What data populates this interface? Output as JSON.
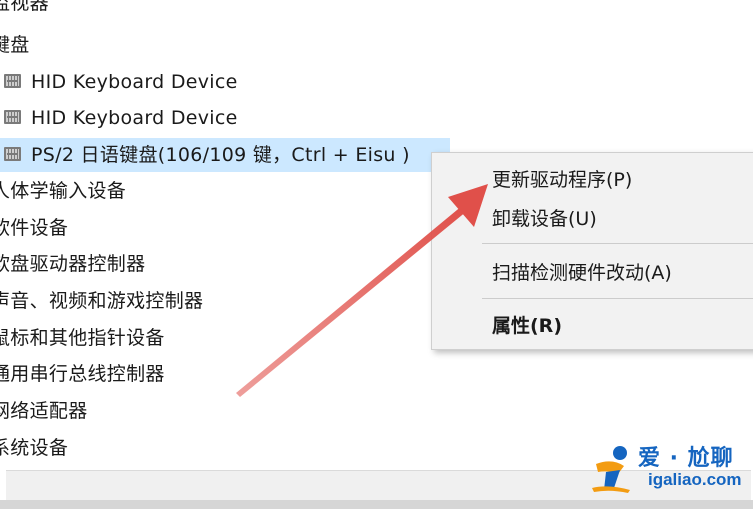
{
  "tree": {
    "partial_top": "监视器",
    "keyboard_category": "键盘",
    "keyboard_devices": [
      {
        "label": "HID Keyboard Device"
      },
      {
        "label": "HID Keyboard Device"
      },
      {
        "label": "PS/2 日语键盘(106/109 键，Ctrl + Eisu )"
      }
    ],
    "categories": [
      {
        "label": "人体学输入设备"
      },
      {
        "label": "软件设备"
      },
      {
        "label": "软盘驱动器控制器"
      },
      {
        "label": "声音、视频和游戏控制器"
      },
      {
        "label": "鼠标和其他指针设备"
      },
      {
        "label": "通用串行总线控制器"
      },
      {
        "label": "网络适配器"
      },
      {
        "label": "系统设备"
      }
    ]
  },
  "context_menu": {
    "update_driver": "更新驱动程序(P)",
    "uninstall_device": "卸载设备(U)",
    "scan_hardware": "扫描检测硬件改动(A)",
    "properties": "属性(R)"
  },
  "watermark": {
    "top_text": "爱 · 尬聊",
    "bottom_text": "igaliao.com"
  },
  "colors": {
    "selection": "#cce8ff",
    "arrow": "#e0504a",
    "menu_bg": "#f2f2f2",
    "watermark_blue": "#1565c0",
    "watermark_orange": "#f39c12"
  }
}
